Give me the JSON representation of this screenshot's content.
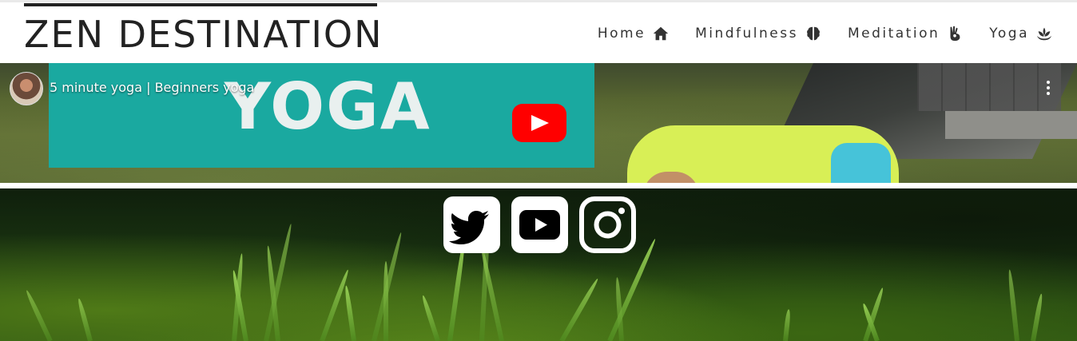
{
  "header": {
    "logo": "ZEN DESTINATION",
    "nav": [
      {
        "label": "Home",
        "icon": "home-icon"
      },
      {
        "label": "Mindfulness",
        "icon": "brain-icon"
      },
      {
        "label": "Meditation",
        "icon": "meditation-hand-icon"
      },
      {
        "label": "Yoga",
        "icon": "lotus-icon"
      }
    ]
  },
  "video": {
    "title": "5 minute yoga | Beginners yoga",
    "thumbnail_text": "YOGA",
    "play_color": "#ff0000"
  },
  "footer": {
    "socials": [
      {
        "name": "twitter",
        "icon": "twitter-icon"
      },
      {
        "name": "youtube",
        "icon": "youtube-icon"
      },
      {
        "name": "instagram",
        "icon": "instagram-icon"
      }
    ]
  },
  "colors": {
    "thumbnail_teal": "#1aa9a0",
    "text_dark": "#222222"
  }
}
